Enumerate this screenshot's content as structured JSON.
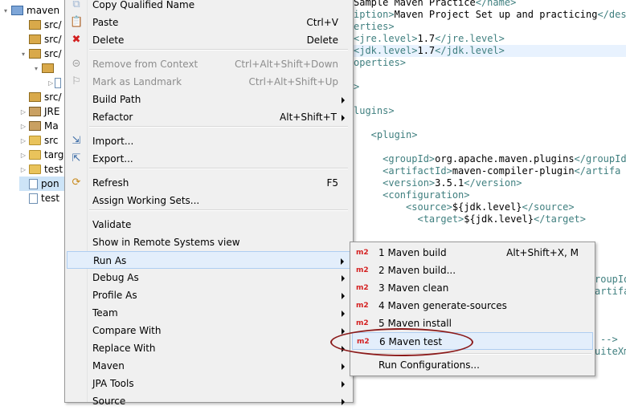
{
  "explorer": {
    "rows": [
      {
        "label": "maven",
        "icon": "maven-project-icon",
        "twisty": "▾"
      },
      {
        "label": "src/",
        "icon": "source-folder-icon",
        "twisty": ""
      },
      {
        "label": "src/",
        "icon": "source-folder-icon",
        "twisty": ""
      },
      {
        "label": "src/",
        "icon": "source-folder-icon",
        "twisty": "▾"
      },
      {
        "label": "",
        "icon": "package-icon",
        "twisty": "▾"
      },
      {
        "label": "",
        "icon": "java-file-icon",
        "twisty": "▷"
      },
      {
        "label": "src/",
        "icon": "source-folder-icon",
        "twisty": ""
      },
      {
        "label": "JRE",
        "icon": "library-icon",
        "twisty": "▷"
      },
      {
        "label": "Ma",
        "icon": "library-icon",
        "twisty": "▷"
      },
      {
        "label": "src",
        "icon": "folder-icon",
        "twisty": "▷"
      },
      {
        "label": "targ",
        "icon": "folder-icon",
        "twisty": "▷"
      },
      {
        "label": "test",
        "icon": "folder-icon",
        "twisty": "▷"
      },
      {
        "label": "pon",
        "icon": "xml-file-icon",
        "twisty": ""
      },
      {
        "label": "test",
        "icon": "xml-file-icon",
        "twisty": ""
      }
    ]
  },
  "editor": {
    "lines": [
      {
        "parts": [
          {
            "t": "Sample Maven Practice",
            "c": "text"
          },
          {
            "t": "</name>",
            "c": "tag"
          }
        ]
      },
      {
        "parts": [
          {
            "t": "iption>",
            "c": "tag"
          },
          {
            "t": "Maven Project Set up and practicing",
            "c": "text"
          },
          {
            "t": "</descr",
            "c": "tag"
          }
        ]
      },
      {
        "parts": [
          {
            "t": "erties>",
            "c": "tag"
          }
        ]
      },
      {
        "parts": [
          {
            "t": "<jre.level>",
            "c": "tag"
          },
          {
            "t": "1.7",
            "c": "text"
          },
          {
            "t": "</jre.level>",
            "c": "tag"
          }
        ]
      },
      {
        "parts": [
          {
            "t": "<jdk.level>",
            "c": "tag"
          },
          {
            "t": "1.7",
            "c": "text"
          },
          {
            "t": "</jdk.level>",
            "c": "tag"
          }
        ]
      },
      {
        "parts": [
          {
            "t": "operties>",
            "c": "tag"
          }
        ]
      },
      {
        "parts": [
          {
            "t": ">",
            "c": "tag"
          }
        ]
      },
      {
        "parts": [
          {
            "t": "lugins>",
            "c": "tag"
          }
        ]
      },
      {
        "parts": [
          {
            "t": "   <plugin>",
            "c": "tag"
          }
        ]
      },
      {
        "parts": [
          {
            "t": "     <groupId>",
            "c": "tag"
          },
          {
            "t": "org.apache.maven.plugins",
            "c": "text"
          },
          {
            "t": "</groupId",
            "c": "tag"
          }
        ]
      },
      {
        "parts": [
          {
            "t": "     <artifactId>",
            "c": "tag"
          },
          {
            "t": "maven-compiler-plugin",
            "c": "text"
          },
          {
            "t": "</artifa",
            "c": "tag"
          }
        ]
      },
      {
        "parts": [
          {
            "t": "     <version>",
            "c": "tag"
          },
          {
            "t": "3.5.1",
            "c": "text"
          },
          {
            "t": "</version>",
            "c": "tag"
          }
        ]
      },
      {
        "parts": [
          {
            "t": "     <configuration>",
            "c": "tag"
          }
        ]
      },
      {
        "parts": [
          {
            "t": "         <source>",
            "c": "tag"
          },
          {
            "t": "${jdk.level}",
            "c": "text"
          },
          {
            "t": "</source>",
            "c": "tag"
          }
        ]
      },
      {
        "parts": [
          {
            "t": "           <target>",
            "c": "tag"
          },
          {
            "t": "${jdk.level}",
            "c": "text"
          },
          {
            "t": "</target>",
            "c": "tag"
          }
        ]
      },
      {
        "parts": [
          {
            "t": "roupId",
            "c": "tag"
          }
        ]
      },
      {
        "parts": [
          {
            "t": "artifa",
            "c": "tag"
          }
        ]
      },
      {
        "parts": [
          {
            "t": "-->",
            "c": "tag"
          }
        ]
      },
      {
        "parts": [
          {
            "t": "uiteXm",
            "c": "tag"
          }
        ]
      }
    ]
  },
  "context_menu": {
    "items": [
      {
        "label": "Copy Qualified Name",
        "shortcut": "",
        "submenu": false,
        "disabled": false,
        "icon": "copy-icon"
      },
      {
        "label": "Paste",
        "shortcut": "Ctrl+V",
        "submenu": false,
        "disabled": false,
        "icon": "paste-icon"
      },
      {
        "label": "Delete",
        "shortcut": "Delete",
        "submenu": false,
        "disabled": false,
        "icon": "delete-icon"
      },
      {
        "label": "Remove from Context",
        "shortcut": "Ctrl+Alt+Shift+Down",
        "submenu": false,
        "disabled": true,
        "icon": "remove-context-icon"
      },
      {
        "label": "Mark as Landmark",
        "shortcut": "Ctrl+Alt+Shift+Up",
        "submenu": false,
        "disabled": true,
        "icon": "landmark-icon"
      },
      {
        "label": "Build Path",
        "shortcut": "",
        "submenu": true,
        "disabled": false,
        "icon": ""
      },
      {
        "label": "Refactor",
        "shortcut": "Alt+Shift+T",
        "submenu": true,
        "disabled": false,
        "icon": ""
      },
      {
        "label": "Import...",
        "shortcut": "",
        "submenu": false,
        "disabled": false,
        "icon": "import-icon"
      },
      {
        "label": "Export...",
        "shortcut": "",
        "submenu": false,
        "disabled": false,
        "icon": "export-icon"
      },
      {
        "label": "Refresh",
        "shortcut": "F5",
        "submenu": false,
        "disabled": false,
        "icon": "refresh-icon"
      },
      {
        "label": "Assign Working Sets...",
        "shortcut": "",
        "submenu": false,
        "disabled": false,
        "icon": ""
      },
      {
        "label": "Validate",
        "shortcut": "",
        "submenu": false,
        "disabled": false,
        "icon": ""
      },
      {
        "label": "Show in Remote Systems view",
        "shortcut": "",
        "submenu": false,
        "disabled": false,
        "icon": ""
      },
      {
        "label": "Run As",
        "shortcut": "",
        "submenu": true,
        "disabled": false,
        "icon": "",
        "active": true
      },
      {
        "label": "Debug As",
        "shortcut": "",
        "submenu": true,
        "disabled": false,
        "icon": ""
      },
      {
        "label": "Profile As",
        "shortcut": "",
        "submenu": true,
        "disabled": false,
        "icon": ""
      },
      {
        "label": "Team",
        "shortcut": "",
        "submenu": true,
        "disabled": false,
        "icon": ""
      },
      {
        "label": "Compare With",
        "shortcut": "",
        "submenu": true,
        "disabled": false,
        "icon": ""
      },
      {
        "label": "Replace With",
        "shortcut": "",
        "submenu": true,
        "disabled": false,
        "icon": ""
      },
      {
        "label": "Maven",
        "shortcut": "",
        "submenu": true,
        "disabled": false,
        "icon": ""
      },
      {
        "label": "JPA Tools",
        "shortcut": "",
        "submenu": true,
        "disabled": false,
        "icon": ""
      },
      {
        "label": "Source",
        "shortcut": "",
        "submenu": true,
        "disabled": false,
        "icon": ""
      }
    ]
  },
  "run_as_submenu": {
    "badge": "m2",
    "items": [
      {
        "label": "1 Maven build",
        "shortcut": "Alt+Shift+X, M",
        "badge": true
      },
      {
        "label": "2 Maven build...",
        "shortcut": "",
        "badge": true
      },
      {
        "label": "3 Maven clean",
        "shortcut": "",
        "badge": true
      },
      {
        "label": "4 Maven generate-sources",
        "shortcut": "",
        "badge": true
      },
      {
        "label": "5 Maven install",
        "shortcut": "",
        "badge": true
      },
      {
        "label": "6 Maven test",
        "shortcut": "",
        "badge": true,
        "hover": true
      },
      {
        "label": "Run Configurations...",
        "shortcut": "",
        "badge": false
      }
    ]
  },
  "colors": {
    "menu_bg": "#f0f0f0",
    "hover_bg": "#e3eefb",
    "m2_badge": "#d41f1f",
    "annotation_ellipse": "#8b1a1a",
    "xml_tag": "#3f7f7f"
  }
}
